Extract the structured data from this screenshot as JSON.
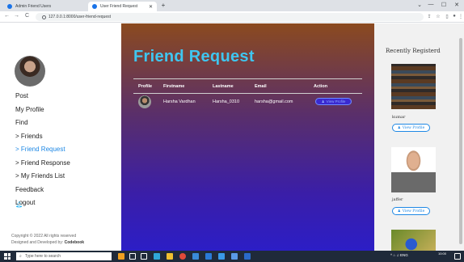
{
  "browser": {
    "tabs": [
      {
        "label": "Admin Friend Users",
        "active": false
      },
      {
        "label": "User Friend Request",
        "active": true
      }
    ],
    "new_tab": "+",
    "url": "127.0.0.1:8000/user-friend-request",
    "nav": {
      "back": "←",
      "forward": "→",
      "reload": "C"
    },
    "window": {
      "minimize": "—",
      "maximize": "☐",
      "close": "✕",
      "collapse": "⌄"
    }
  },
  "sidebar": {
    "items": [
      {
        "label": "Post"
      },
      {
        "label": "My Profile"
      },
      {
        "label": "Find"
      },
      {
        "label": "> Friends"
      },
      {
        "label": "> Friend Request",
        "active": true
      },
      {
        "label": "> Friend Response"
      },
      {
        "label": "> My Friends List"
      },
      {
        "label": "Feedback"
      },
      {
        "label": "Logout"
      }
    ],
    "copyright_line1": "Copyright © 2022 All rights reserved",
    "copyright_prefix": "Designed and Developed by: ",
    "copyright_brand": "Codebook"
  },
  "main": {
    "title": "Friend Request",
    "columns": [
      "Profile",
      "Firstname",
      "Lastname",
      "Email",
      "Action"
    ],
    "rows": [
      {
        "firstname": "Harsha Vardhan",
        "lastname": "Harsha_0310",
        "email": "harsha@gmail.com",
        "action": "View Profile"
      }
    ]
  },
  "recent": {
    "title": "Recently Registerd",
    "users": [
      {
        "name": "kumar",
        "button": "View Profile"
      },
      {
        "name": "jaffer",
        "button": "View Profile"
      }
    ]
  },
  "taskbar": {
    "search_placeholder": "Type here to search",
    "tray": "^  ⌂  ♫  ENG",
    "time": "10:00"
  },
  "colors": {
    "title_accent": "#3fc6f0",
    "active_link": "#1e88e5",
    "gradient_top": "#8b4a1f",
    "gradient_bottom": "#2c1ec6"
  }
}
